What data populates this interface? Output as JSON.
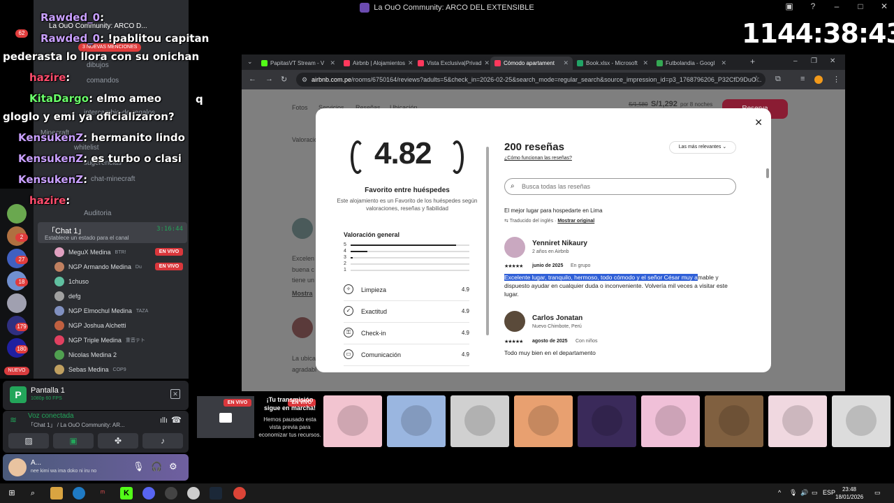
{
  "window": {
    "title": "La OuO Community: ARCO DEL EXTENSIBLE"
  },
  "timer": "1144:38:43",
  "chat": [
    {
      "user": "Rawded_0",
      "color": "#c9a0ff",
      "msg": ":"
    },
    {
      "user": "Rawded_0",
      "color": "#c9a0ff",
      "msg": ": !pablitou capitan"
    },
    {
      "user": "",
      "color": "#fff",
      "msg": "pederasta lo llora con su onichan"
    },
    {
      "user": "hazire",
      "color": "#ff4d6d",
      "msg": ":"
    },
    {
      "user": "KitaDargo",
      "color": "#6bff6b",
      "msg": ": elmo ameo"
    },
    {
      "user": "",
      "color": "#fff",
      "msg": "gloglo y emi ya oficializaron?"
    },
    {
      "user": "KensukenZ",
      "color": "#c9a0ff",
      "msg": ": hermanito lindo"
    },
    {
      "user": "KensukenZ",
      "color": "#c9a0ff",
      "msg": ": es turbo o clasi"
    },
    {
      "user": "KensukenZ",
      "color": "#c9a0ff",
      "msg": ":"
    },
    {
      "user": "hazire",
      "color": "#ff4d6d",
      "msg": ":"
    }
  ],
  "chat_extra": {
    "q": "q"
  },
  "discord": {
    "server_header": "La OuO Community: ARCO D...",
    "mentions_badge": "3 NUEVAS MENCIONES",
    "nuevo_badge": "NUEVO",
    "server_badges": [
      "62",
      "27",
      "18",
      "179",
      "180",
      "2"
    ],
    "channels": [
      "dibujos",
      "comandos",
      "intercambio-de-regalos",
      "Minecraft",
      "whitelist",
      "sugerencias",
      "chat-minecraft",
      "Auditoria"
    ],
    "active_channel": {
      "name": "「Chat 1」",
      "status": "Establece un estado para el canal",
      "time": "3:16:44"
    },
    "voice_users": [
      {
        "name": "MeguX Medina",
        "extra": "BTR!",
        "live": true,
        "color": "#e0a0c0"
      },
      {
        "name": "NGP Armando Medina",
        "extra": "Du",
        "live": true,
        "color": "#c08060"
      },
      {
        "name": "1chuso",
        "extra": "",
        "live": false,
        "color": "#60c0a0"
      },
      {
        "name": "defg",
        "extra": "",
        "live": false,
        "color": "#a0a0a0"
      },
      {
        "name": "NGP Elmochul Medina",
        "extra": "TAZA",
        "live": false,
        "color": "#8090c0"
      },
      {
        "name": "NGP Joshua Alchetti",
        "extra": "",
        "live": false,
        "color": "#c06040"
      },
      {
        "name": "NGP Triple Medina",
        "extra": "重音テト",
        "live": false,
        "color": "#e04060"
      },
      {
        "name": "Nicolas Medina 2",
        "extra": "",
        "live": false,
        "color": "#50a050"
      },
      {
        "name": "Sebas Medina",
        "extra": "COP9",
        "live": false,
        "color": "#c0a060"
      }
    ],
    "live_label": "EN VIVO",
    "screen_panel": {
      "title": "Pantalla 1",
      "quality": "1080p 60 FPS"
    },
    "voice_panel": {
      "title": "Voz conectada",
      "channel": "「Chat 1」 / La OuO Community: AR..."
    },
    "user_panel": {
      "name": "A...",
      "status": "nee kimi wa ima doko ni iru no"
    }
  },
  "browser": {
    "tabs": [
      {
        "label": "PapitasVT Stream - V",
        "color": "#53fc18"
      },
      {
        "label": "Airbnb | Alojamientos",
        "color": "#ff385c"
      },
      {
        "label": "Vista Exclusiva|Privad",
        "color": "#ff385c"
      },
      {
        "label": "Cómodo apartament",
        "color": "#ff385c",
        "active": true
      },
      {
        "label": "Book.xlsx - Microsoft",
        "color": "#21a366"
      },
      {
        "label": "Futbolandia - Googl",
        "color": "#34a853"
      }
    ],
    "new_tab": "+",
    "url_domain": "airbnb.com.pe",
    "url_path": "/rooms/6750164/reviews?adults=5&check_in=2026-02-25&search_mode=regular_search&source_impression_id=p3_1768796206_P32CfD9DuO...",
    "page_bg": {
      "nav": [
        "Fotos",
        "Servicios",
        "Reseñas",
        "Ubicación"
      ],
      "price_old": "S/1,580",
      "price_new": "S/1,292",
      "price_suffix": "por 8 noches",
      "reserve": "Reserva",
      "val_label": "Valoracion",
      "excerpt1": "Excelen",
      "excerpt2": "buena c",
      "excerpt3": "tiene un",
      "show_more": "Mostra",
      "loc1": "La ubica",
      "loc2": "agradabl"
    }
  },
  "modal": {
    "rating": "4.82",
    "fav_title": "Favorito entre huéspedes",
    "fav_desc": "Este alojamiento es un Favorito de los huéspedes según valoraciones, reseñas y fiabilidad",
    "overall_label": "Valoración general",
    "histogram": [
      {
        "star": "5",
        "fraction": 0.89
      },
      {
        "star": "4",
        "fraction": 0.14
      },
      {
        "star": "3",
        "fraction": 0.02
      },
      {
        "star": "2",
        "fraction": 0
      },
      {
        "star": "1",
        "fraction": 0
      }
    ],
    "categories": [
      {
        "label": "Limpieza",
        "value": "4.9",
        "icon": "spray-icon"
      },
      {
        "label": "Exactitud",
        "value": "4.9",
        "icon": "check-circle-icon"
      },
      {
        "label": "Check-in",
        "value": "4.9",
        "icon": "key-icon"
      },
      {
        "label": "Comunicación",
        "value": "4.9",
        "icon": "chat-icon"
      }
    ],
    "reviews_title": "200 reseñas",
    "reviews_link": "¿Cómo funcionan las reseñas?",
    "sort_label": "Las más relevantes",
    "search_placeholder": "Busca todas las reseñas",
    "prev_review_title": "El mejor lugar para hospedarte en Lima",
    "translated_note": "Traducido del inglés",
    "show_original": "Mostrar original",
    "reviews": [
      {
        "name": "Yenniret Nikaury",
        "meta": "2 años en Airbnb",
        "date": "junio de 2025",
        "group": "En grupo",
        "text_highlight": "Excelente lugar, tranquilo, hermoso, todo cómodo y el señor César muy a",
        "text_rest": "mable y dispuesto ayudar en cualquier duda o inconveniente. Volvería mil veces a visitar este lugar."
      },
      {
        "name": "Carlos Jonatan",
        "meta": "Nuevo Chimbote, Perú",
        "date": "agosto de 2025",
        "group": "Con niños",
        "text_highlight": "",
        "text_rest": "Todo muy bien en el departamento"
      }
    ]
  },
  "stream": {
    "paused_title": "¡Tu transmisión sigue en marcha!",
    "paused_desc": "Hemos pausado esta vista previa para economizar tus recursos.",
    "live_label": "EN VIVO",
    "viewer_colors": [
      "#f2c4d0",
      "#9ab6e0",
      "#d0d0d0",
      "#e8a070",
      "#3a2a5a",
      "#f0c0d8",
      "#806040",
      "#f0d8e0",
      "#dcdcdc"
    ]
  },
  "taskbar": {
    "lang": "ESP",
    "time": "23:48",
    "date": "18/01/2026"
  }
}
